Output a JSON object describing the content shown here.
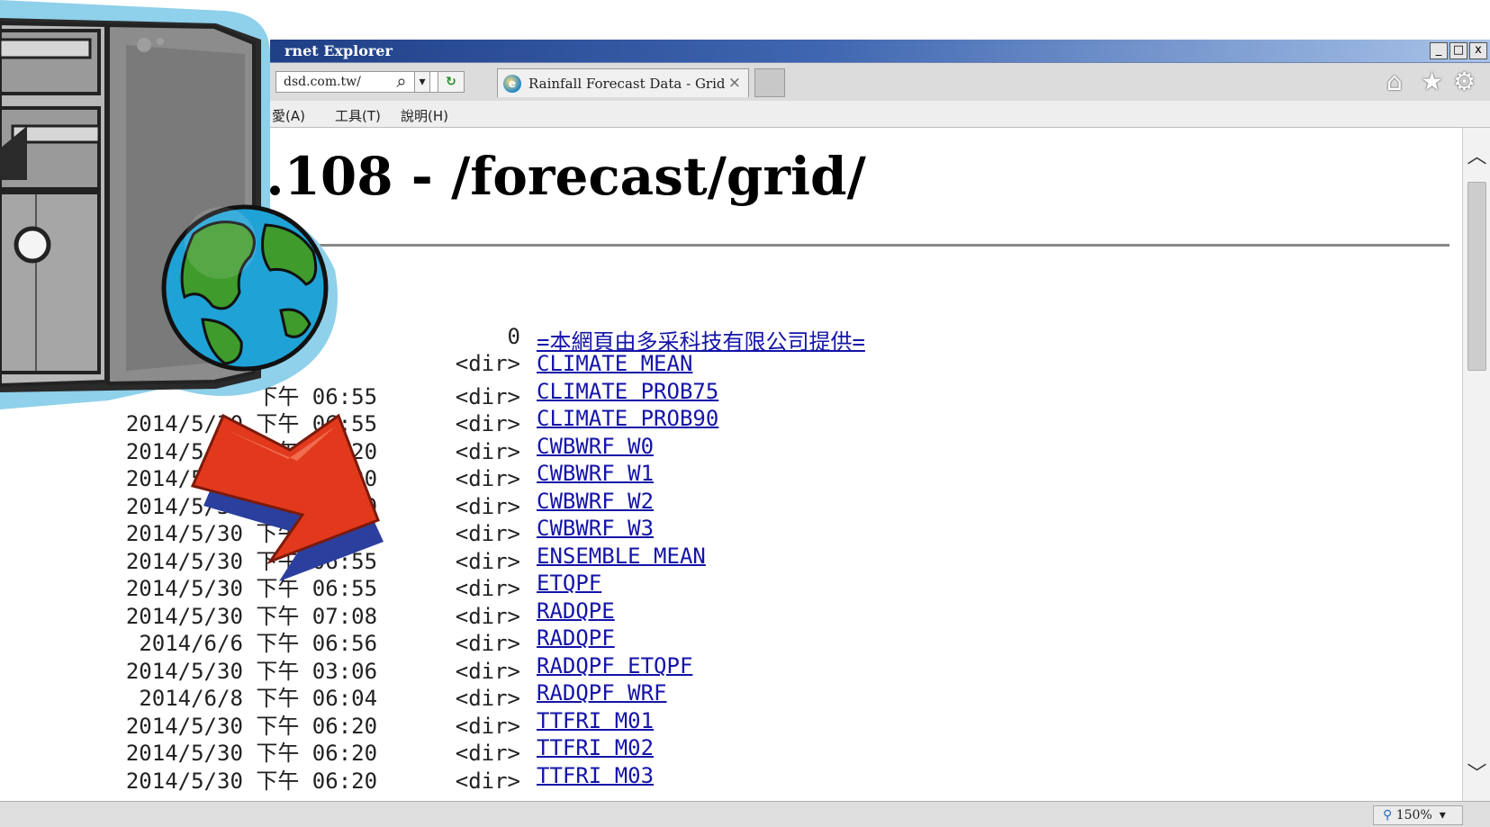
{
  "window": {
    "title": "rnet Explorer",
    "minimize_glyph": "_",
    "maximize_glyph": "□",
    "close_glyph": "x"
  },
  "addressbar": {
    "url": "dsd.com.tw/",
    "search_glyph": "⌕",
    "dropdown_glyph": "▾",
    "refresh_glyph": "↻",
    "tab_title": "Rainfall Forecast Data - Grid",
    "tab_close": "×",
    "home_icon": "⌂",
    "favorites_icon": "★",
    "settings_icon": "⚙"
  },
  "menubar": {
    "items": [
      "愛(A)",
      "工具(T)",
      "說明(H)"
    ]
  },
  "page": {
    "heading": "8.108 - /forecast/grid/",
    "entries": [
      {
        "meta": "0",
        "name": "=本網頁由多采科技有限公司提供="
      },
      {
        "meta": "<dir>",
        "name": "CLIMATE MEAN"
      },
      {
        "meta": "下午 06:55      <dir>",
        "name": "CLIMATE PROB75"
      },
      {
        "meta": "2014/5/30 下午 06:55      <dir>",
        "name": "CLIMATE PROB90"
      },
      {
        "meta": "2014/5/30 下午 06:20      <dir>",
        "name": "CWBWRF W0"
      },
      {
        "meta": "2014/5/30 下午 06:20      <dir>",
        "name": "CWBWRF W1"
      },
      {
        "meta": "2014/5/30 下午 06:20      <dir>",
        "name": "CWBWRF W2"
      },
      {
        "meta": "2014/5/30 下午 06:20      <dir>",
        "name": "CWBWRF W3"
      },
      {
        "meta": "2014/5/30 下午 06:55      <dir>",
        "name": "ENSEMBLE MEAN"
      },
      {
        "meta": "2014/5/30 下午 06:55      <dir>",
        "name": "ETQPF"
      },
      {
        "meta": "2014/5/30 下午 07:08      <dir>",
        "name": "RADQPE"
      },
      {
        "meta": "2014/6/6 下午 06:56      <dir>",
        "name": "RADQPF"
      },
      {
        "meta": "2014/5/30 下午 03:06      <dir>",
        "name": "RADQPF ETQPF"
      },
      {
        "meta": "2014/6/8 下午 06:04      <dir>",
        "name": "RADQPF WRF"
      },
      {
        "meta": "2014/5/30 下午 06:20      <dir>",
        "name": "TTFRI M01"
      },
      {
        "meta": "2014/5/30 下午 06:20      <dir>",
        "name": "TTFRI M02"
      },
      {
        "meta": "2014/5/30 下午 06:20      <dir>",
        "name": "TTFRI M03"
      }
    ]
  },
  "scrollbar": {
    "up": "︿",
    "down": "﹀"
  },
  "statusbar": {
    "zoom": "150%"
  },
  "colors": {
    "link": "#1414a8",
    "titlebar": "#2b4d96",
    "arrow": "#e2391c",
    "globe_ocean": "#1fa2d6",
    "globe_land": "#3f9b2c"
  }
}
